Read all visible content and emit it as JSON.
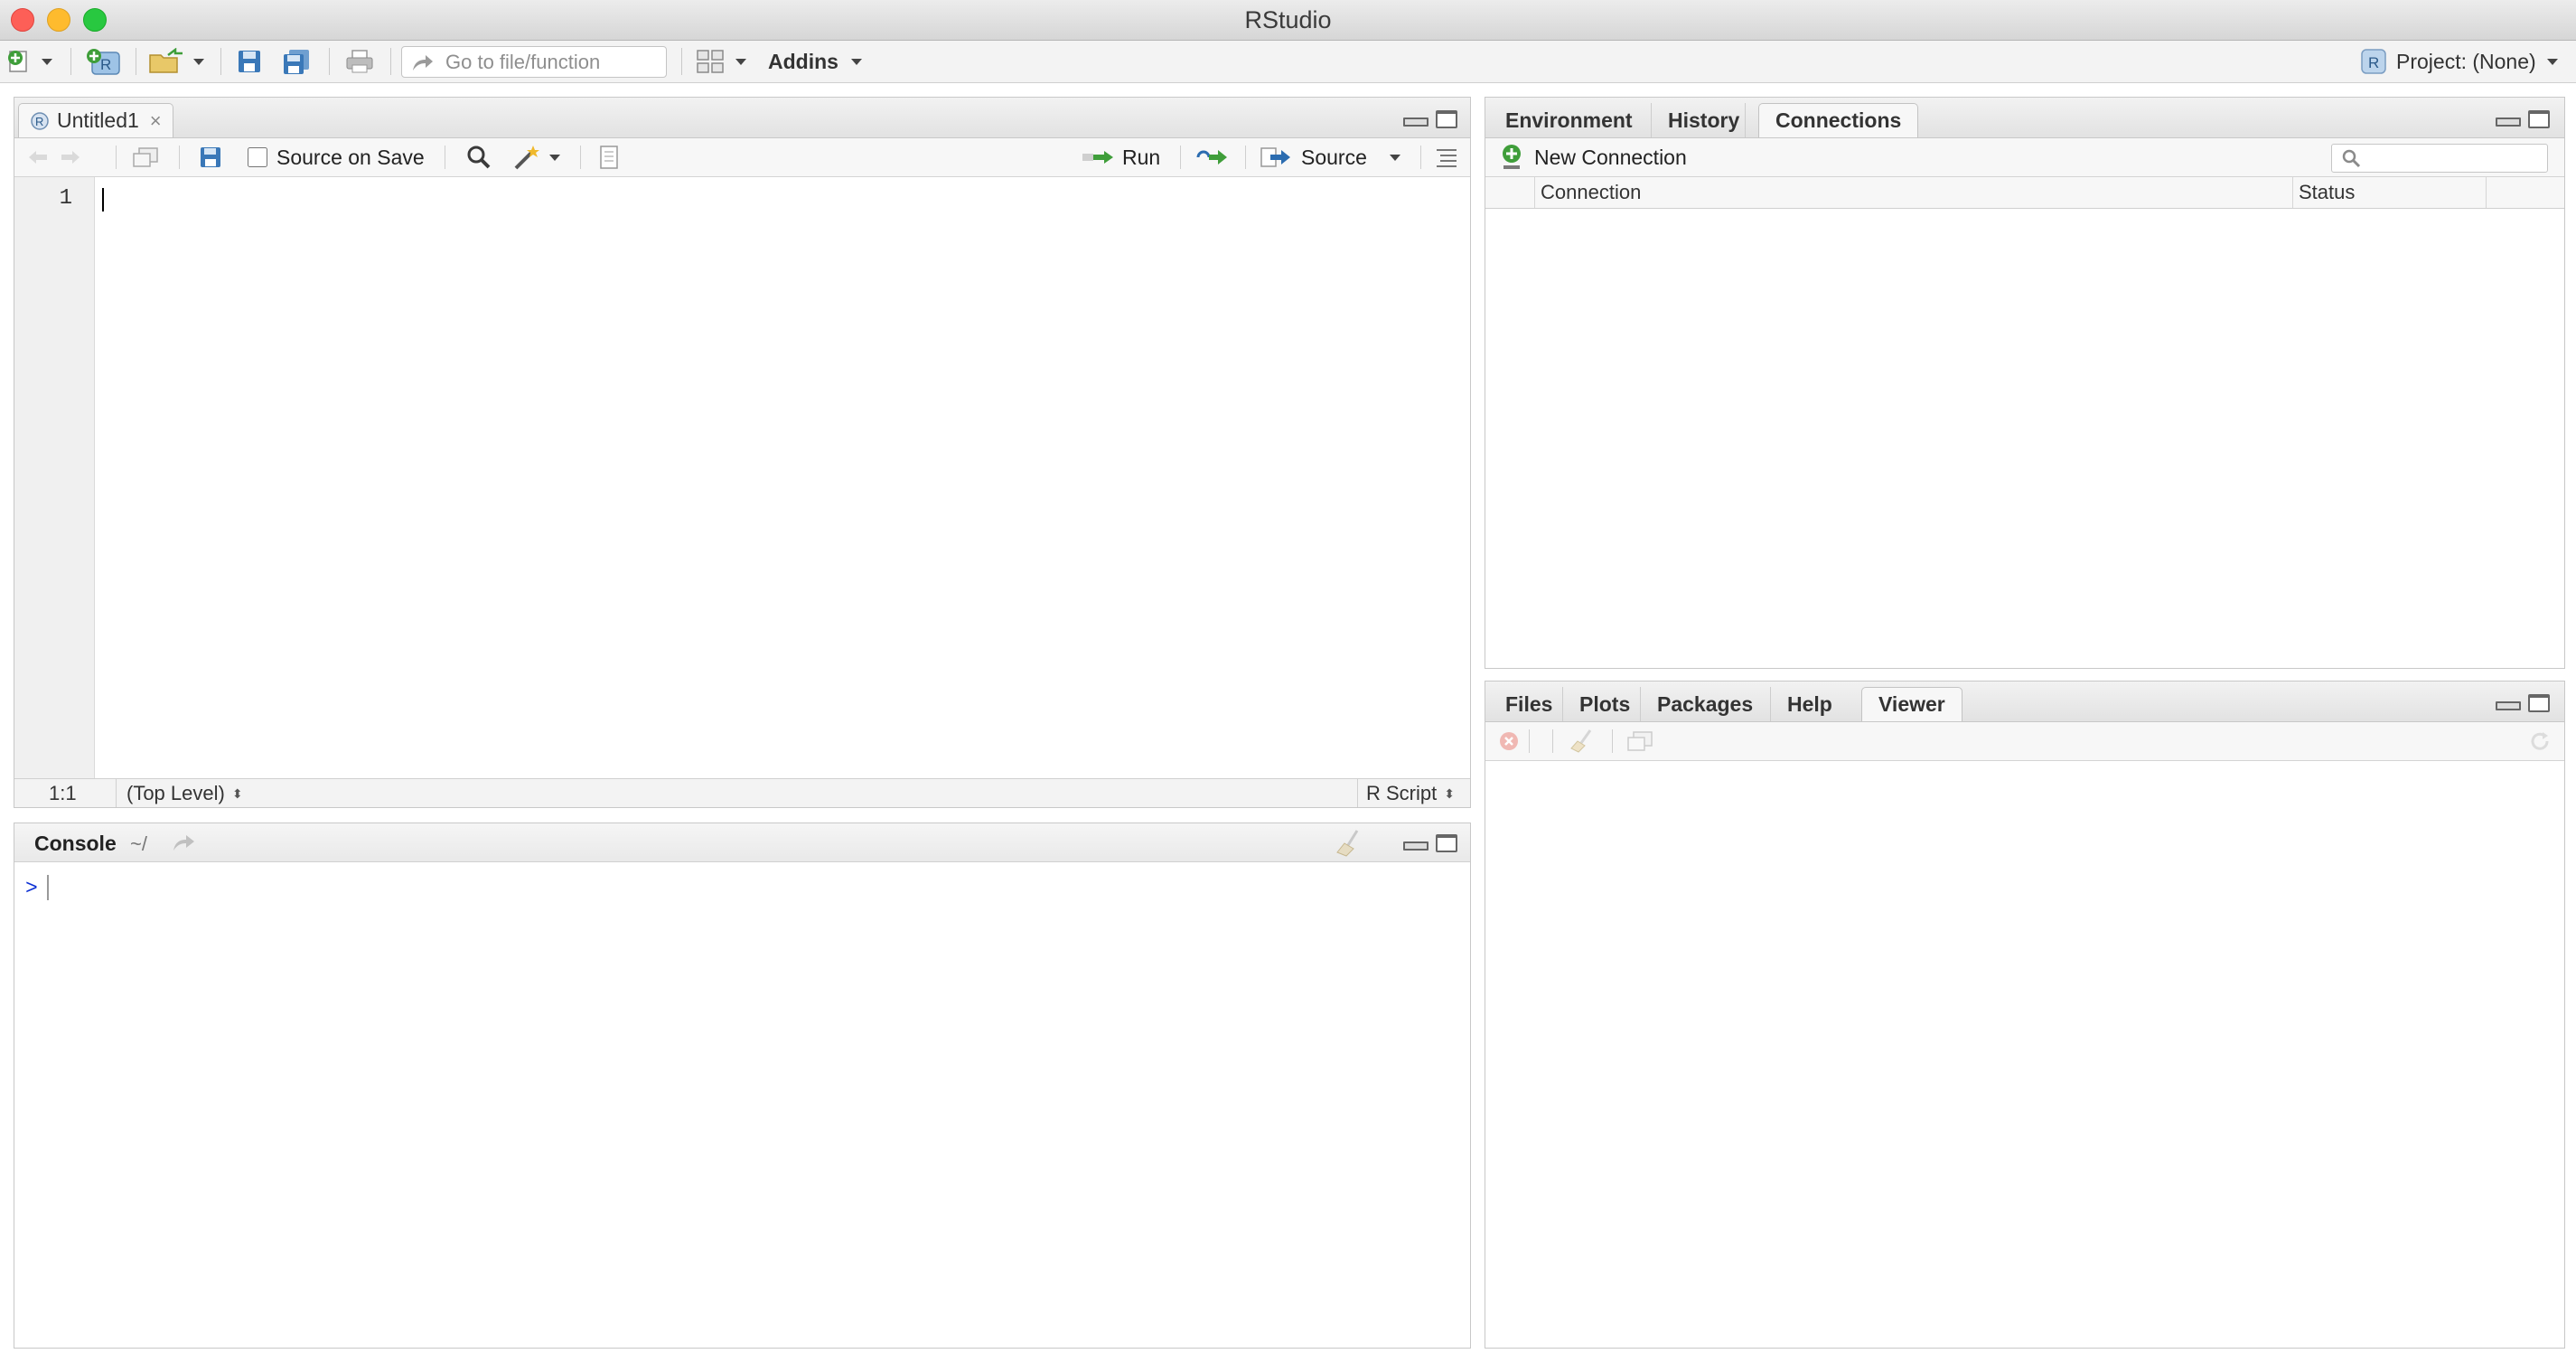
{
  "window": {
    "title": "RStudio"
  },
  "toolbar": {
    "goto_placeholder": "Go to file/function",
    "addins_label": "Addins",
    "project_label": "Project: (None)"
  },
  "source_pane": {
    "tab_label": "Untitled1",
    "source_on_save_label": "Source on Save",
    "source_on_save_checked": false,
    "run_label": "Run",
    "source_label": "Source",
    "line_numbers": [
      "1"
    ],
    "status": {
      "position": "1:1",
      "scope": "(Top Level)",
      "file_type": "R Script"
    }
  },
  "console_pane": {
    "title": "Console",
    "path": "~/",
    "prompt": ">"
  },
  "env_pane": {
    "tabs": [
      {
        "label": "Environment",
        "selected": false
      },
      {
        "label": "History",
        "selected": false
      },
      {
        "label": "Connections",
        "selected": true
      }
    ],
    "new_connection_label": "New Connection",
    "search_placeholder": "",
    "columns": [
      "Connection",
      "Status"
    ]
  },
  "files_pane": {
    "tabs": [
      {
        "label": "Files",
        "selected": false
      },
      {
        "label": "Plots",
        "selected": false
      },
      {
        "label": "Packages",
        "selected": false
      },
      {
        "label": "Help",
        "selected": false
      },
      {
        "label": "Viewer",
        "selected": true
      }
    ]
  },
  "icons": [
    "new-file-icon",
    "new-project-icon",
    "open-file-icon",
    "save-icon",
    "save-all-icon",
    "print-icon",
    "goto-arrow-icon",
    "pane-layout-icon",
    "r-project-icon",
    "back-arrow-icon",
    "forward-arrow-icon",
    "show-in-window-icon",
    "search-icon",
    "magic-wand-icon",
    "compile-report-icon",
    "run-arrow-icon",
    "rerun-icon",
    "source-icon",
    "outline-icon",
    "clear-console-icon",
    "add-connection-icon",
    "remove-icon",
    "broom-icon",
    "export-icon",
    "refresh-icon"
  ],
  "colors": {
    "accent_green": "#3f9e3a",
    "prompt_blue": "#0b2fd4",
    "close_red": "#fd5f57"
  }
}
